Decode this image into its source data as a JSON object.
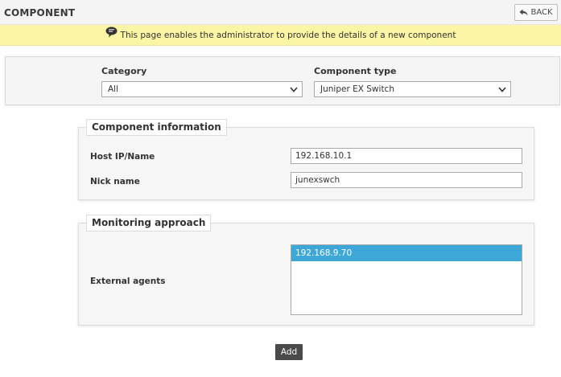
{
  "header": {
    "title": "COMPONENT",
    "back_label": "BACK"
  },
  "info": {
    "message": "This page enables the administrator to provide the details of a new component"
  },
  "filters": {
    "category_label": "Category",
    "category_value": "All",
    "component_type_label": "Component type",
    "component_type_value": "Juniper EX Switch"
  },
  "component_info": {
    "legend": "Component information",
    "host_label": "Host IP/Name",
    "host_value": "192.168.10.1",
    "nick_label": "Nick name",
    "nick_value": "junexswch"
  },
  "monitoring": {
    "legend": "Monitoring approach",
    "agents_label": "External agents",
    "agents": [
      "192.168.9.70"
    ]
  },
  "actions": {
    "add_label": "Add"
  },
  "colors": {
    "info_bar": "#fbf5a6",
    "selected_item": "#3da8d8",
    "add_button": "#4a4a4a"
  }
}
